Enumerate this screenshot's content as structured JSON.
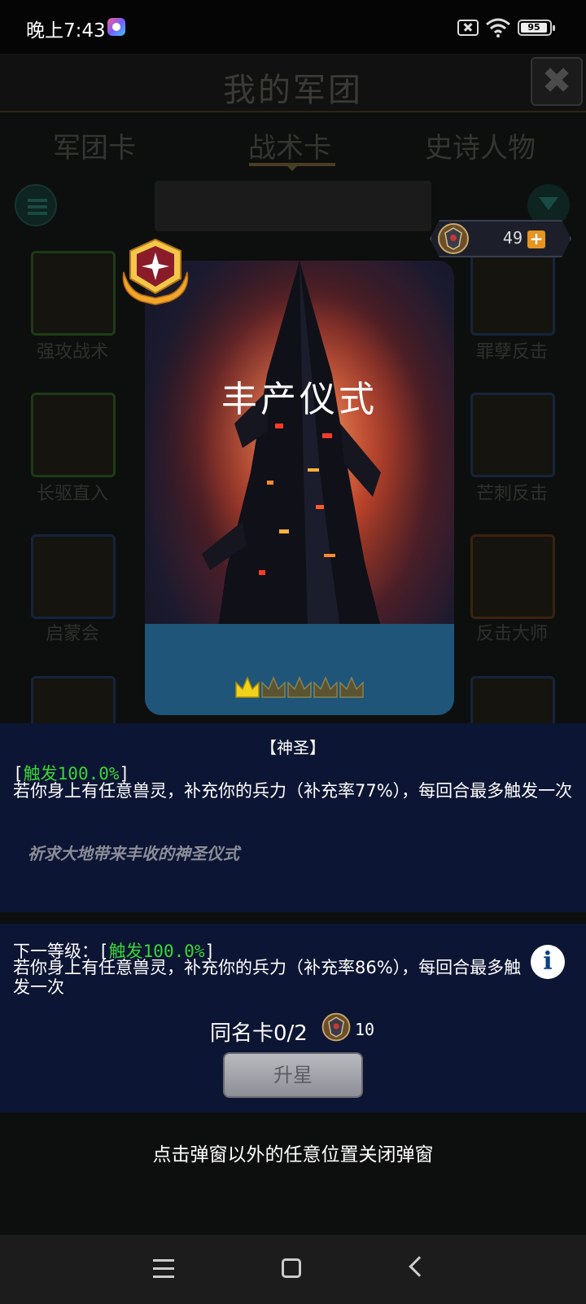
{
  "status_bar": {
    "time": "晚上7:43",
    "battery": "95"
  },
  "background": {
    "title": "我的军团",
    "tabs": [
      "军团卡",
      "战术卡",
      "史诗人物"
    ],
    "card_labels": {
      "row1_left": "强攻战术",
      "row1_right": "罪孽反击",
      "row2_left": "长驱直入",
      "row2_right": "芒刺反击",
      "row3_left": "启蒙会",
      "row3_right": "反击大师"
    }
  },
  "currency": {
    "value": "49"
  },
  "card": {
    "name": "丰产仪式",
    "stars_filled": 1,
    "stars_total": 5
  },
  "info": {
    "trait": "【神圣】",
    "trigger_open": "[",
    "trigger": "触发100.0%",
    "trigger_close": "]",
    "description": "若你身上有任意兽灵，补充你的兵力（补充率77%），每回合最多触发一次",
    "flavor": "祈求大地带来丰收的神圣仪式"
  },
  "next_level": {
    "label": "下一等级：[",
    "trigger": "触发100.0%",
    "trigger_close": "]",
    "description": "若你身上有任意兽灵，补充你的兵力（补充率86%），每回合最多触发一次"
  },
  "same_card": {
    "label": "同名卡0/2",
    "cost": "10"
  },
  "upgrade_button": "升星",
  "close_hint": "点击弹窗以外的任意位置关闭弹窗",
  "colors": {
    "panel": "#0c1533",
    "trigger_green": "#39d639",
    "name_bar": "#1f5578",
    "accent_orange": "#e69422"
  }
}
